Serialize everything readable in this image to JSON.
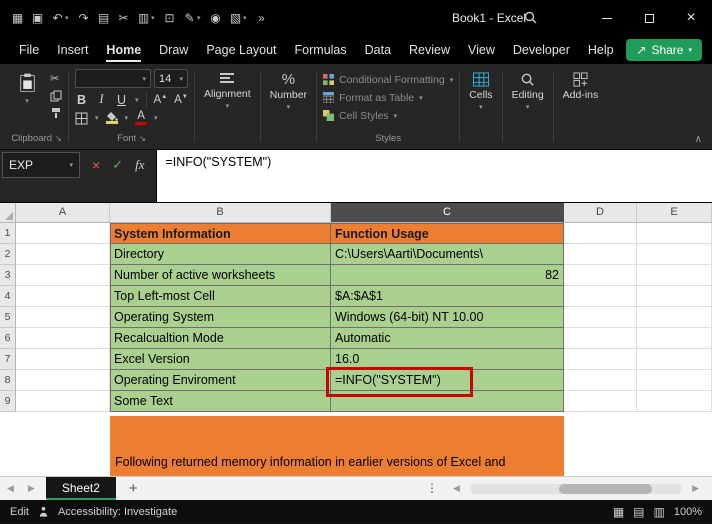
{
  "colors": {
    "accent_green": "#21A366",
    "share_green": "#1E9E5A",
    "cell_orange": "#ED7D31",
    "cell_green": "#A9D08E",
    "annotation_red": "#CB0000",
    "titlebar_bg": "#000000",
    "ribbon_bg": "#262626"
  },
  "titlebar": {
    "title": "Book1 - Excel",
    "quick_access_icons": [
      "app",
      "save",
      "undo",
      "redo",
      "copy",
      "cut",
      "paste",
      "print",
      "format-painter",
      "camera",
      "table",
      "more-commands"
    ]
  },
  "menubar": {
    "tabs": [
      "File",
      "Insert",
      "Home",
      "Draw",
      "Page Layout",
      "Formulas",
      "Data",
      "Review",
      "View",
      "Developer",
      "Help"
    ],
    "active_tab": "Home",
    "share_label": "Share"
  },
  "ribbon": {
    "clipboard_label": "Clipboard",
    "font_label": "Font",
    "font_size": "14",
    "bold": "B",
    "italic": "I",
    "underline": "U",
    "alignment_label": "Alignment",
    "number_label": "Number",
    "styles_items": [
      "Conditional Formatting",
      "Format as Table",
      "Cell Styles"
    ],
    "styles_label": "Styles",
    "cells_label": "Cells",
    "editing_label": "Editing",
    "addins_label": "Add-ins"
  },
  "formula_bar": {
    "name_box": "EXP",
    "fx_label": "fx",
    "formula": "=INFO(\"SYSTEM\")"
  },
  "sheet": {
    "columns": [
      "A",
      "B",
      "C",
      "D",
      "E"
    ],
    "selected_column": "C",
    "row_numbers": [
      "1",
      "2",
      "3",
      "4",
      "5",
      "6",
      "7",
      "8",
      "9"
    ],
    "rows": [
      {
        "b": "System Information",
        "c": "Function Usage"
      },
      {
        "b": "Directory",
        "c": "C:\\Users\\Aarti\\Documents\\"
      },
      {
        "b": "Number of active worksheets",
        "c": "82"
      },
      {
        "b": "Top Left-most Cell",
        "c": "$A:$A$1"
      },
      {
        "b": "Operating System",
        "c": "Windows (64-bit) NT 10.00"
      },
      {
        "b": "Recalcualtion Mode",
        "c": "Automatic"
      },
      {
        "b": "Excel Version",
        "c": "16.0"
      },
      {
        "b": "Operating Enviroment",
        "c": "=INFO(\"SYSTEM\")"
      },
      {
        "b": "Some Text",
        "c": ""
      }
    ],
    "banner_text": "Following returned memory information in earlier versions of Excel and"
  },
  "sheet_bar": {
    "active_tab": "Sheet2"
  },
  "status_bar": {
    "mode": "Edit",
    "accessibility": "Accessibility: Investigate",
    "zoom": "100%"
  }
}
